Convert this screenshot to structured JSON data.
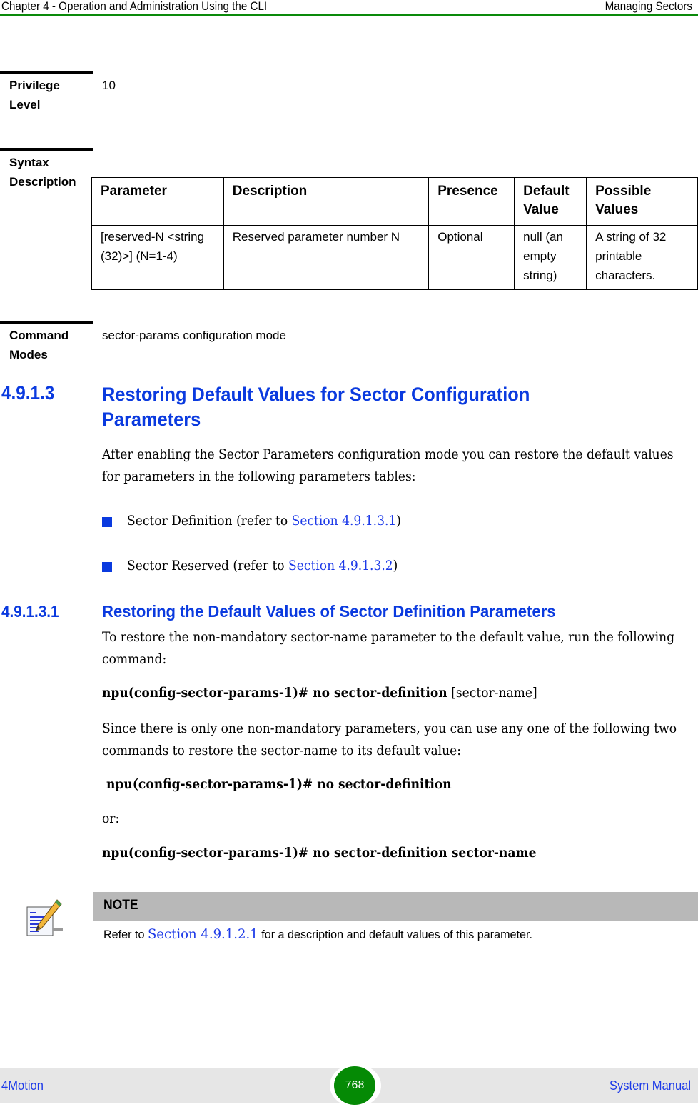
{
  "header": {
    "chapter": "Chapter 4 - Operation and Administration Using the CLI",
    "section": "Managing Sectors"
  },
  "privilege": {
    "label": "Privilege Level",
    "value": "10"
  },
  "syntax": {
    "label": "Syntax Description",
    "table": {
      "headers": [
        "Parameter",
        "Description",
        "Presence",
        "Default Value",
        "Possible Values"
      ],
      "rows": [
        [
          "[reserved-N <string (32)>] (N=1-4)",
          "Reserved parameter number N",
          "Optional",
          "null (an empty string)",
          "A string of 32 printable characters."
        ]
      ]
    }
  },
  "command_modes": {
    "label": "Command Modes",
    "value": "sector-params configuration mode"
  },
  "section_4_9_1_3": {
    "number": "4.9.1.3",
    "title": "Restoring Default Values for Sector Configuration Parameters",
    "intro": "After enabling the Sector Parameters configuration mode you can restore the default values for parameters in the following parameters tables:",
    "bullets": [
      {
        "text": "Sector Definition (refer to ",
        "link": "Section 4.9.1.3.1",
        "suffix": ")"
      },
      {
        "text": "Sector Reserved (refer to ",
        "link": "Section 4.9.1.3.2",
        "suffix": ")"
      }
    ]
  },
  "section_4_9_1_3_1": {
    "number": "4.9.1.3.1",
    "title": "Restoring the Default Values of Sector Definition Parameters",
    "intro": "To restore the non-mandatory sector-name parameter to the default value, run the following command:",
    "command1_bold": "npu(config-sector-params-1)# no sector-definition",
    "command1_arg": " [sector-name]",
    "para": "Since there is only one non-mandatory parameters, you can use any one of the following two commands to restore the sector-name to its default value:",
    "command2": "npu(config-sector-params-1)# no sector-definition",
    "or": "or:",
    "command3": "npu(config-sector-params-1)# no sector-definition sector-name"
  },
  "note": {
    "title": "NOTE",
    "prefix": "Refer to ",
    "link": "Section 4.9.1.2.1",
    "suffix": " for a description and default values of this parameter."
  },
  "footer": {
    "left": "4Motion",
    "page": "768",
    "right": "System Manual"
  },
  "colors": {
    "heading": "#0a3adf",
    "link": "#1e3be8",
    "header_rule": "#0a8a0a",
    "page_badge": "#058a05",
    "note_bar": "#b8b8b8",
    "footer_bg": "#e6e6e6"
  }
}
